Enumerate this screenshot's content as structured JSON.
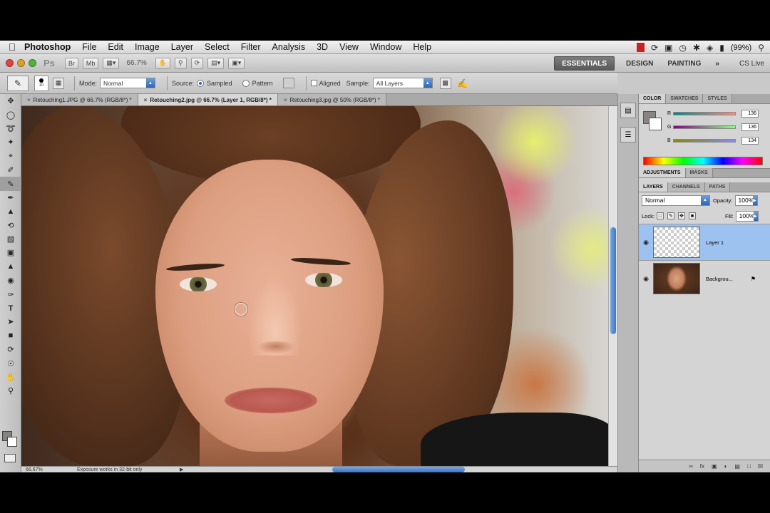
{
  "menubar": {
    "app_name": "Photoshop",
    "items": [
      "File",
      "Edit",
      "Image",
      "Layer",
      "Select",
      "Filter",
      "Analysis",
      "3D",
      "View",
      "Window",
      "Help"
    ],
    "battery": "(99%)"
  },
  "appbar": {
    "logo": "Ps",
    "btn_br": "Br",
    "btn_mb": "Mb",
    "zoom": "66.7%",
    "workspaces": [
      "ESSENTIALS",
      "DESIGN",
      "PAINTING"
    ],
    "more": "»",
    "cs_live": "CS Live"
  },
  "options": {
    "brush_size": "10",
    "mode_label": "Mode:",
    "mode_value": "Normal",
    "source_label": "Source:",
    "sampled": "Sampled",
    "pattern": "Pattern",
    "aligned": "Aligned",
    "sample_label": "Sample:",
    "sample_value": "All Layers"
  },
  "doc_tabs": [
    {
      "label": "Retouching1.JPG @ 66.7% (RGB/8*) *"
    },
    {
      "label": "Retouching2.jpg @ 66.7% (Layer 1, RGB/8*) *"
    },
    {
      "label": "Retouching3.jpg @ 50% (RGB/8*) *"
    }
  ],
  "status": {
    "zoom": "66.67%",
    "message": "Exposure works in 32-bit only"
  },
  "color_panel": {
    "tabs": [
      "COLOR",
      "SWATCHES",
      "STYLES"
    ],
    "channels": [
      {
        "label": "R",
        "value": "136"
      },
      {
        "label": "G",
        "value": "136"
      },
      {
        "label": "B",
        "value": "134"
      }
    ]
  },
  "adjust_tabs": [
    "ADJUSTMENTS",
    "MASKS"
  ],
  "layers_panel": {
    "tabs": [
      "LAYERS",
      "CHANNELS",
      "PATHS"
    ],
    "blend_mode": "Normal",
    "opacity_label": "Opacity:",
    "opacity": "100%",
    "lock_label": "Lock:",
    "fill_label": "Fill:",
    "fill": "100%",
    "layers": [
      {
        "name": "Layer 1"
      },
      {
        "name": "Backgrou..."
      }
    ]
  },
  "colors": {
    "canvas_bg": "#c9c9c9",
    "selected_layer": "#9ec2f0",
    "accent": "#2f66b3"
  }
}
